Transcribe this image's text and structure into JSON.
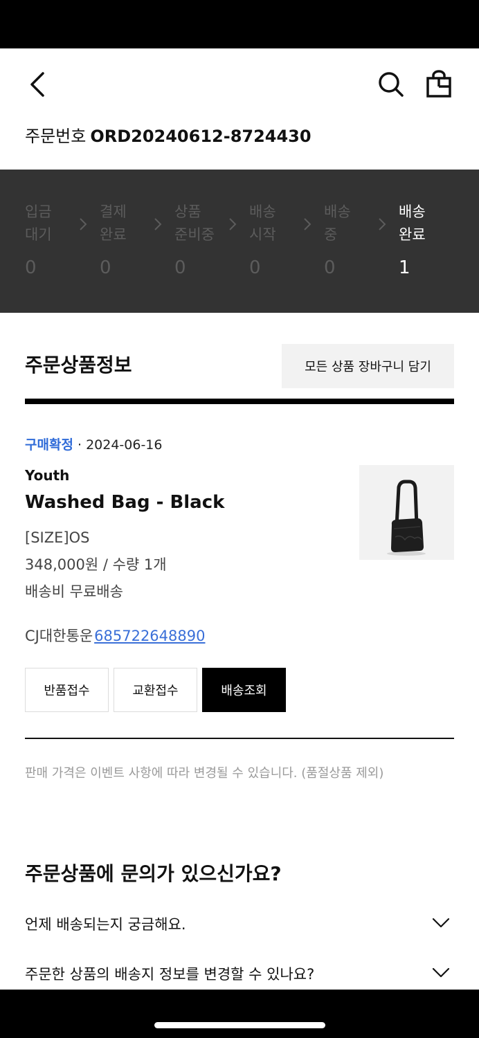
{
  "header": {
    "back_icon": "chevron-left-icon",
    "search_icon": "search-icon",
    "cart_icon": "shopping-bag-icon",
    "order_label": "주문번호",
    "order_number": "ORD20240612-8724430"
  },
  "progress": {
    "steps": [
      {
        "label": "입금\n대기",
        "count": "0"
      },
      {
        "label": "결제\n완료",
        "count": "0"
      },
      {
        "label": "상품\n준비중",
        "count": "0"
      },
      {
        "label": "배송\n시작",
        "count": "0"
      },
      {
        "label": "배송\n중",
        "count": "0"
      },
      {
        "label": "배송\n완료",
        "count": "1"
      }
    ],
    "active_step": "배송\n완료",
    "active_color": "#ffffff",
    "inactive_color": "#5c5c5c",
    "panel_color": "#333333"
  },
  "order_items": {
    "title": "주문상품정보",
    "add_all_button": "모든 상품 장바구니 담기",
    "item": {
      "status": "구매확정",
      "status_color": "#2f6bd8",
      "separator": "·",
      "date": "2024-06-16",
      "brand": "Youth",
      "name": "Washed Bag - Black",
      "option": "[SIZE]OS",
      "price_qty": "348,000원 / 수량 1개",
      "shipping": "배송비 무료배송",
      "courier": "CJ대한통운",
      "tracking_number": "685722648890",
      "buttons": {
        "return": "반품접수",
        "exchange": "교환접수",
        "track": "배송조회"
      }
    },
    "notice": "판매 가격은 이벤트 사항에 따라 변경될 수 있습니다. (품절상품 제외)"
  },
  "faq": {
    "title": "주문상품에 문의가 있으신가요?",
    "items": [
      {
        "question": "언제 배송되는지 궁금해요."
      },
      {
        "question": "주문한 상품의 배송지 정보를 변경할 수 있나요?"
      }
    ]
  }
}
